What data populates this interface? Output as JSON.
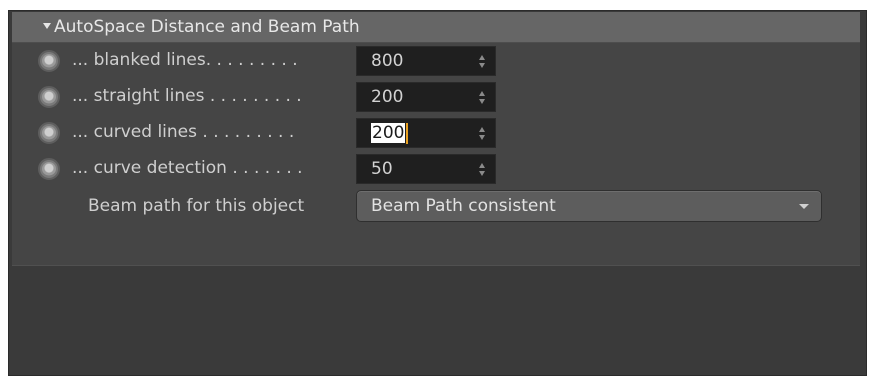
{
  "section": {
    "title": "AutoSpace Distance and Beam Path"
  },
  "rows": [
    {
      "label": "... blanked lines. . . . . . . . .",
      "value": "800"
    },
    {
      "label": "... straight lines . . . . . . . . .",
      "value": "200"
    },
    {
      "label": "... curved lines . . . . . . . . .",
      "value": "200"
    },
    {
      "label": "... curve detection . . . . . . .",
      "value": "50"
    }
  ],
  "beam_path": {
    "label": "Beam path for this object",
    "selected": "Beam Path consistent"
  },
  "icons": {
    "collapse": "triangle-down-icon",
    "radio": "radio-icon",
    "spinner": "spinner-arrows-icon",
    "dropdown": "chevron-down-icon"
  },
  "colors": {
    "panel": "#3a3a3a",
    "header": "#666666",
    "field": "#1f1f1f",
    "caret": "#e8a020"
  }
}
